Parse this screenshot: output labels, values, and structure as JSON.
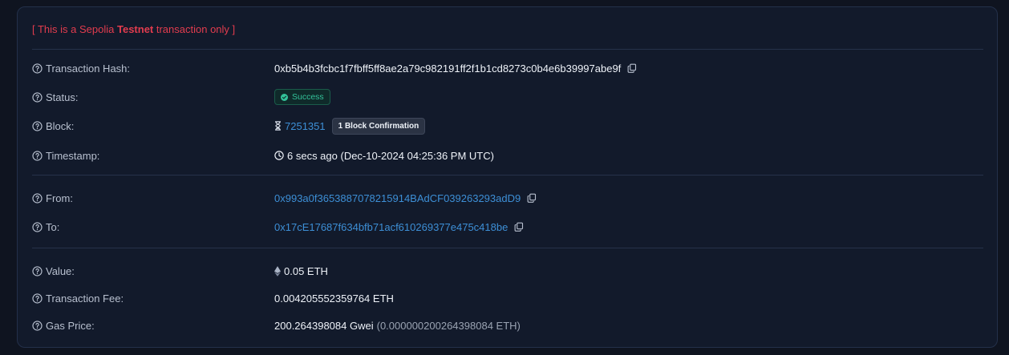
{
  "notice": {
    "prefix": "[ This is a Sepolia ",
    "emphasis": "Testnet",
    "suffix": " transaction only ]"
  },
  "fields": {
    "tx_hash": {
      "label": "Transaction Hash:",
      "value": "0xb5b4b3fcbc1f7fbff5ff8ae2a79c982191ff2f1b1cd8273c0b4e6b39997abe9f"
    },
    "status": {
      "label": "Status:",
      "value": "Success"
    },
    "block": {
      "label": "Block:",
      "value": "7251351",
      "confirmations": "1 Block Confirmation"
    },
    "timestamp": {
      "label": "Timestamp:",
      "value": "6 secs ago (Dec-10-2024 04:25:36 PM UTC)"
    },
    "from": {
      "label": "From:",
      "value": "0x993a0f3653887078215914BAdCF039263293adD9"
    },
    "to": {
      "label": "To:",
      "value": "0x17cE17687f634bfb71acf610269377e475c418be"
    },
    "value": {
      "label": "Value:",
      "value": "0.05 ETH"
    },
    "fee": {
      "label": "Transaction Fee:",
      "value": "0.004205552359764 ETH"
    },
    "gas_price": {
      "label": "Gas Price:",
      "value": "200.264398084 Gwei",
      "secondary": "(0.000000200264398084 ETH)"
    }
  },
  "icons": {
    "help": "question-circle-icon",
    "copy": "copy-icon",
    "success": "check-circle-icon",
    "block": "hourglass-icon",
    "timestamp": "clock-icon",
    "value": "ethereum-icon"
  },
  "colors": {
    "notice": "#e23c4e",
    "link": "#3d8fd6",
    "success": "#33c29a",
    "background": "#0f1420",
    "card": "#121a2b"
  }
}
